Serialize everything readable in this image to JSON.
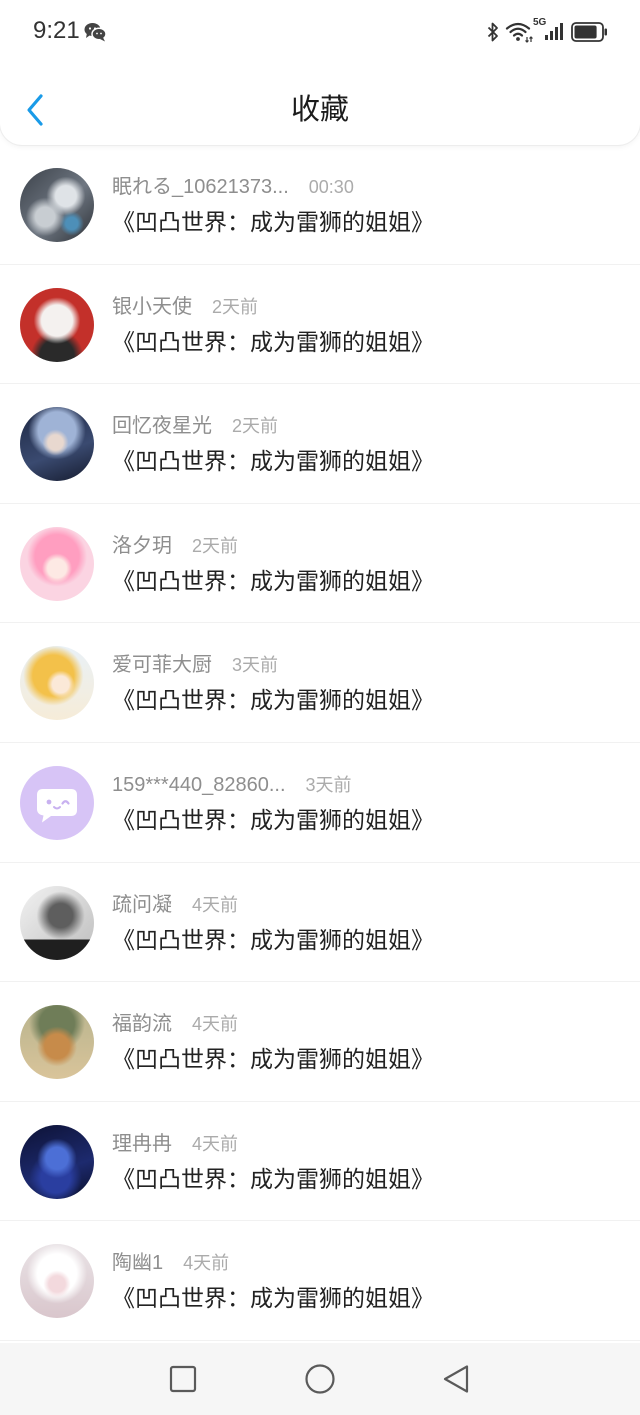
{
  "status_bar": {
    "time": "9:21",
    "network_label": "5G",
    "battery_level": 0.85,
    "icons": [
      "wechat-icon",
      "bluetooth-icon",
      "wifi-icon",
      "signal-icon",
      "battery-icon"
    ]
  },
  "header": {
    "title": "收藏",
    "back_icon": "chevron-left-icon"
  },
  "items": [
    {
      "name": "眠れる_10621373...",
      "time": "00:30",
      "title": "《凹凸世界：成为雷狮的姐姐》"
    },
    {
      "name": "银小天使",
      "time": "2天前",
      "title": "《凹凸世界：成为雷狮的姐姐》"
    },
    {
      "name": "回忆夜星光",
      "time": "2天前",
      "title": "《凹凸世界：成为雷狮的姐姐》"
    },
    {
      "name": "洛夕玥",
      "time": "2天前",
      "title": "《凹凸世界：成为雷狮的姐姐》"
    },
    {
      "name": "爱可菲大厨",
      "time": "3天前",
      "title": "《凹凸世界：成为雷狮的姐姐》"
    },
    {
      "name": "159***440_82860...",
      "time": "3天前",
      "title": "《凹凸世界：成为雷狮的姐姐》"
    },
    {
      "name": "疏问凝",
      "time": "4天前",
      "title": "《凹凸世界：成为雷狮的姐姐》"
    },
    {
      "name": "福韵流",
      "time": "4天前",
      "title": "《凹凸世界：成为雷狮的姐姐》"
    },
    {
      "name": "理冉冉",
      "time": "4天前",
      "title": "《凹凸世界：成为雷狮的姐姐》"
    },
    {
      "name": "陶幽1",
      "time": "4天前",
      "title": "《凹凸世界：成为雷狮的姐姐》"
    }
  ],
  "nav_bar": {
    "icons": [
      "recent-apps-icon",
      "home-icon",
      "back-icon"
    ]
  },
  "colors": {
    "accent": "#1a9be8",
    "title_text": "#222222",
    "meta_text": "#8e8e8e",
    "nav_bg": "#f6f6f6"
  }
}
